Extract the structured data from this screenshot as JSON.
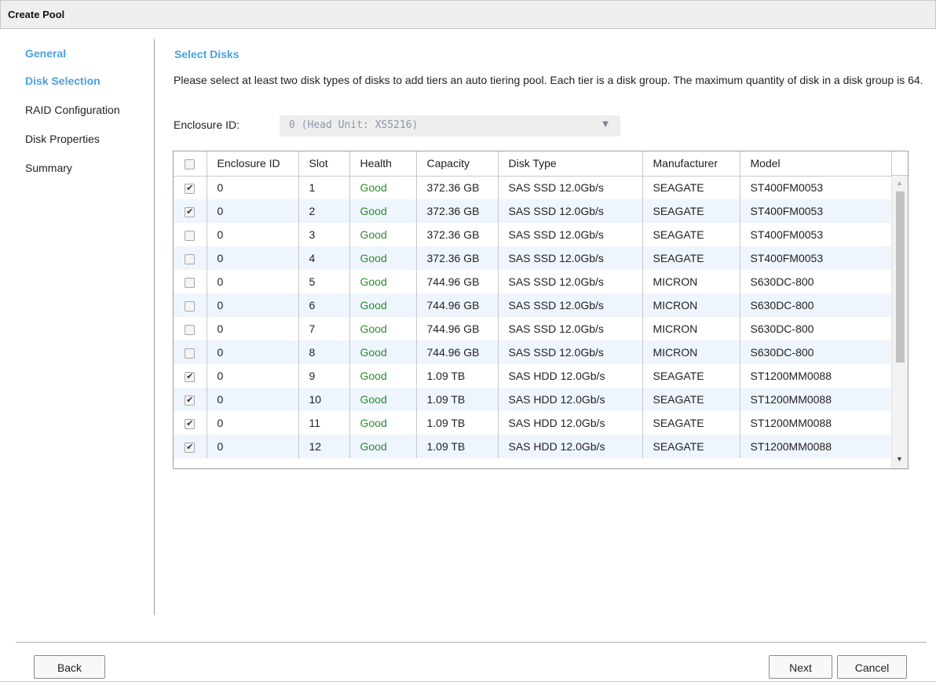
{
  "window": {
    "title": "Create Pool"
  },
  "sidebar": {
    "items": [
      {
        "label": "General",
        "state": "visited"
      },
      {
        "label": "Disk Selection",
        "state": "active"
      },
      {
        "label": "RAID Configuration",
        "state": "pending"
      },
      {
        "label": "Disk Properties",
        "state": "pending"
      },
      {
        "label": "Summary",
        "state": "pending"
      }
    ]
  },
  "main": {
    "section_title": "Select Disks",
    "instructions": "Please select at least two disk types of disks to add tiers an auto tiering pool. Each tier is a disk group. The maximum quantity of disk in a disk group is 64.",
    "enclosure": {
      "label": "Enclosure ID:",
      "selected": "0 (Head Unit: XS5216)"
    },
    "table": {
      "columns": [
        "Enclosure ID",
        "Slot",
        "Health",
        "Capacity",
        "Disk Type",
        "Manufacturer",
        "Model"
      ],
      "rows": [
        {
          "checked": true,
          "enclosure_id": "0",
          "slot": "1",
          "health": "Good",
          "capacity": "372.36 GB",
          "disk_type": "SAS SSD 12.0Gb/s",
          "manufacturer": "SEAGATE",
          "model": "ST400FM0053"
        },
        {
          "checked": true,
          "enclosure_id": "0",
          "slot": "2",
          "health": "Good",
          "capacity": "372.36 GB",
          "disk_type": "SAS SSD 12.0Gb/s",
          "manufacturer": "SEAGATE",
          "model": "ST400FM0053"
        },
        {
          "checked": false,
          "enclosure_id": "0",
          "slot": "3",
          "health": "Good",
          "capacity": "372.36 GB",
          "disk_type": "SAS SSD 12.0Gb/s",
          "manufacturer": "SEAGATE",
          "model": "ST400FM0053"
        },
        {
          "checked": false,
          "enclosure_id": "0",
          "slot": "4",
          "health": "Good",
          "capacity": "372.36 GB",
          "disk_type": "SAS SSD 12.0Gb/s",
          "manufacturer": "SEAGATE",
          "model": "ST400FM0053"
        },
        {
          "checked": false,
          "enclosure_id": "0",
          "slot": "5",
          "health": "Good",
          "capacity": "744.96 GB",
          "disk_type": "SAS SSD 12.0Gb/s",
          "manufacturer": "MICRON",
          "model": "S630DC-800"
        },
        {
          "checked": false,
          "enclosure_id": "0",
          "slot": "6",
          "health": "Good",
          "capacity": "744.96 GB",
          "disk_type": "SAS SSD 12.0Gb/s",
          "manufacturer": "MICRON",
          "model": "S630DC-800"
        },
        {
          "checked": false,
          "enclosure_id": "0",
          "slot": "7",
          "health": "Good",
          "capacity": "744.96 GB",
          "disk_type": "SAS SSD 12.0Gb/s",
          "manufacturer": "MICRON",
          "model": "S630DC-800"
        },
        {
          "checked": false,
          "enclosure_id": "0",
          "slot": "8",
          "health": "Good",
          "capacity": "744.96 GB",
          "disk_type": "SAS SSD 12.0Gb/s",
          "manufacturer": "MICRON",
          "model": "S630DC-800"
        },
        {
          "checked": true,
          "enclosure_id": "0",
          "slot": "9",
          "health": "Good",
          "capacity": "1.09 TB",
          "disk_type": "SAS HDD 12.0Gb/s",
          "manufacturer": "SEAGATE",
          "model": "ST1200MM0088"
        },
        {
          "checked": true,
          "enclosure_id": "0",
          "slot": "10",
          "health": "Good",
          "capacity": "1.09 TB",
          "disk_type": "SAS HDD 12.0Gb/s",
          "manufacturer": "SEAGATE",
          "model": "ST1200MM0088"
        },
        {
          "checked": true,
          "enclosure_id": "0",
          "slot": "11",
          "health": "Good",
          "capacity": "1.09 TB",
          "disk_type": "SAS HDD 12.0Gb/s",
          "manufacturer": "SEAGATE",
          "model": "ST1200MM0088"
        },
        {
          "checked": true,
          "enclosure_id": "0",
          "slot": "12",
          "health": "Good",
          "capacity": "1.09 TB",
          "disk_type": "SAS HDD 12.0Gb/s",
          "manufacturer": "SEAGATE",
          "model": "ST1200MM0088"
        }
      ]
    }
  },
  "footer": {
    "back_label": "Back",
    "next_label": "Next",
    "cancel_label": "Cancel"
  },
  "colors": {
    "accent": "#4a9fe0",
    "health_good": "#2e8b2e",
    "row_alt": "#eef5fd"
  },
  "icons": {
    "checkbox_checked": "✔",
    "dropdown": "▼",
    "scroll_up": "▲",
    "scroll_down": "▼"
  }
}
